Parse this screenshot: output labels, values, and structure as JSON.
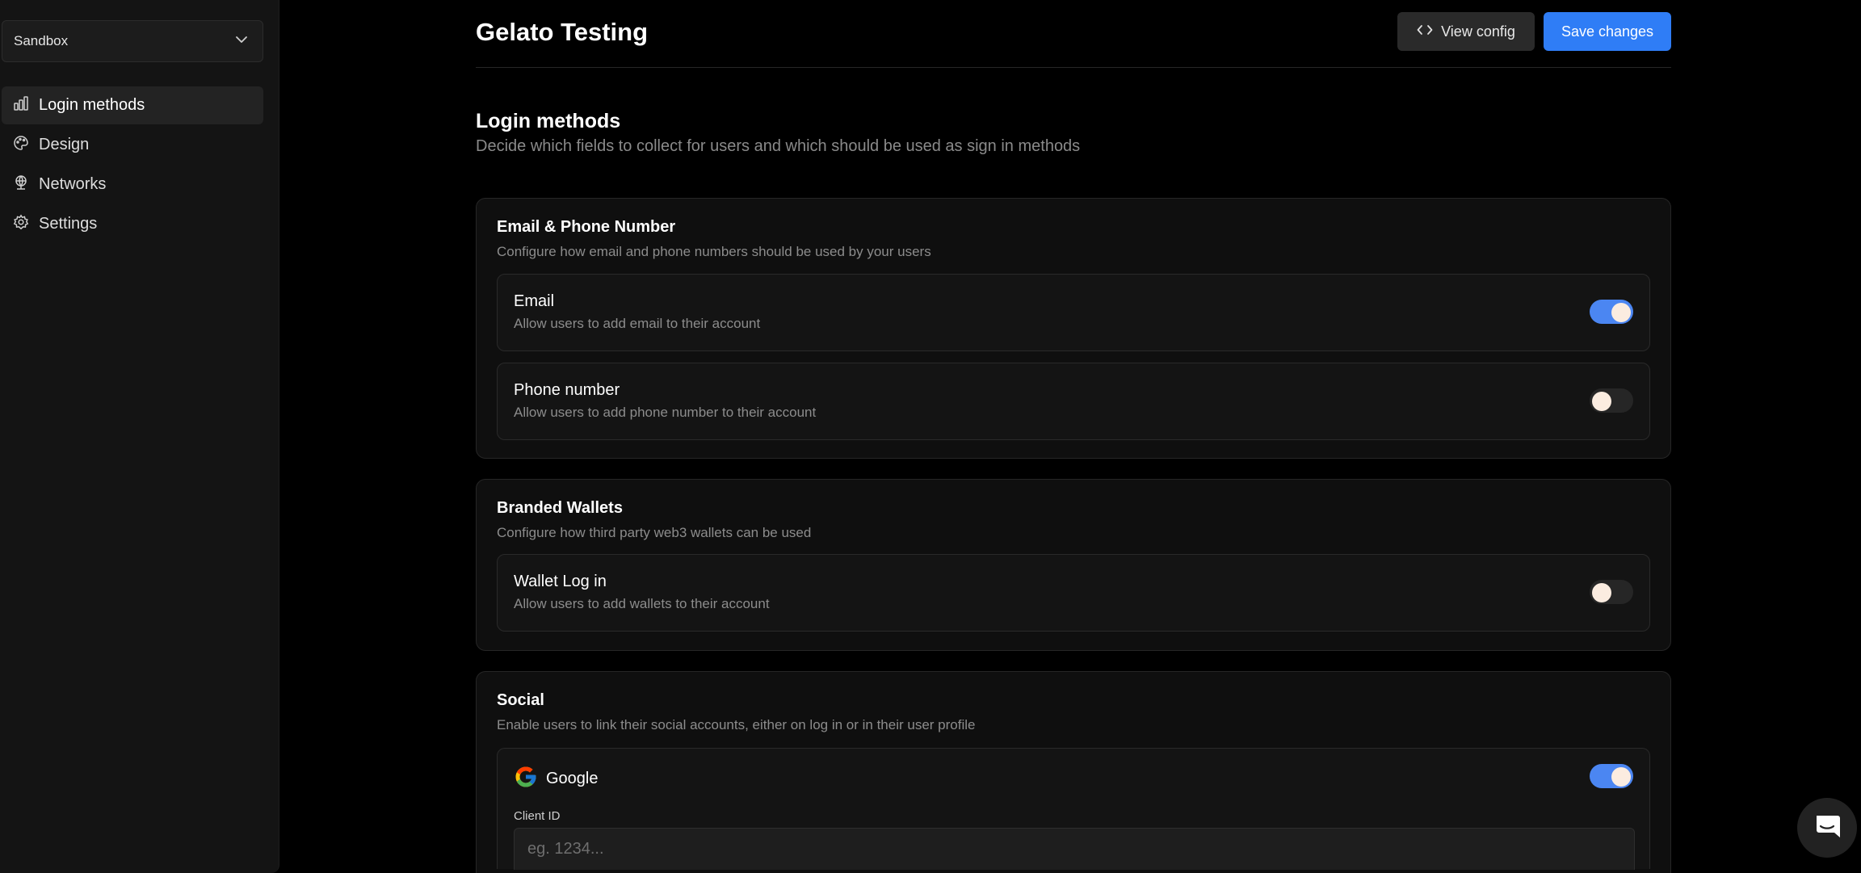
{
  "sidebar": {
    "project_select": {
      "value": "Sandbox"
    },
    "items": [
      {
        "label": "Login methods",
        "icon": "bar-chart-icon",
        "active": true
      },
      {
        "label": "Design",
        "icon": "palette-icon",
        "active": false
      },
      {
        "label": "Networks",
        "icon": "globe-network-icon",
        "active": false
      },
      {
        "label": "Settings",
        "icon": "gear-icon",
        "active": false
      }
    ]
  },
  "header": {
    "title": "Gelato Testing",
    "view_config_label": "View config",
    "save_label": "Save changes"
  },
  "main": {
    "title": "Login methods",
    "description": "Decide which fields to collect for users and which should be used as sign in methods",
    "email_phone": {
      "title": "Email & Phone Number",
      "description": "Configure how email and phone numbers should be used by your users",
      "email": {
        "title": "Email",
        "description": "Allow users to add email to their account",
        "enabled": true
      },
      "phone": {
        "title": "Phone number",
        "description": "Allow users to add phone number to their account",
        "enabled": false
      }
    },
    "wallets": {
      "title": "Branded Wallets",
      "description": "Configure how third party web3 wallets can be used",
      "wallet_login": {
        "title": "Wallet Log in",
        "description": "Allow users to add wallets to their account",
        "enabled": false
      }
    },
    "social": {
      "title": "Social",
      "description": "Enable users to link their social accounts, either on log in or in their user profile",
      "google": {
        "name": "Google",
        "enabled": true,
        "client_id_label": "Client ID",
        "client_id_placeholder": "eg. 1234...",
        "client_id_value": ""
      }
    }
  },
  "colors": {
    "accent": "#2f7df6",
    "toggle_on": "#4b86f2",
    "background": "#000000",
    "sidebar_bg": "#141414"
  }
}
